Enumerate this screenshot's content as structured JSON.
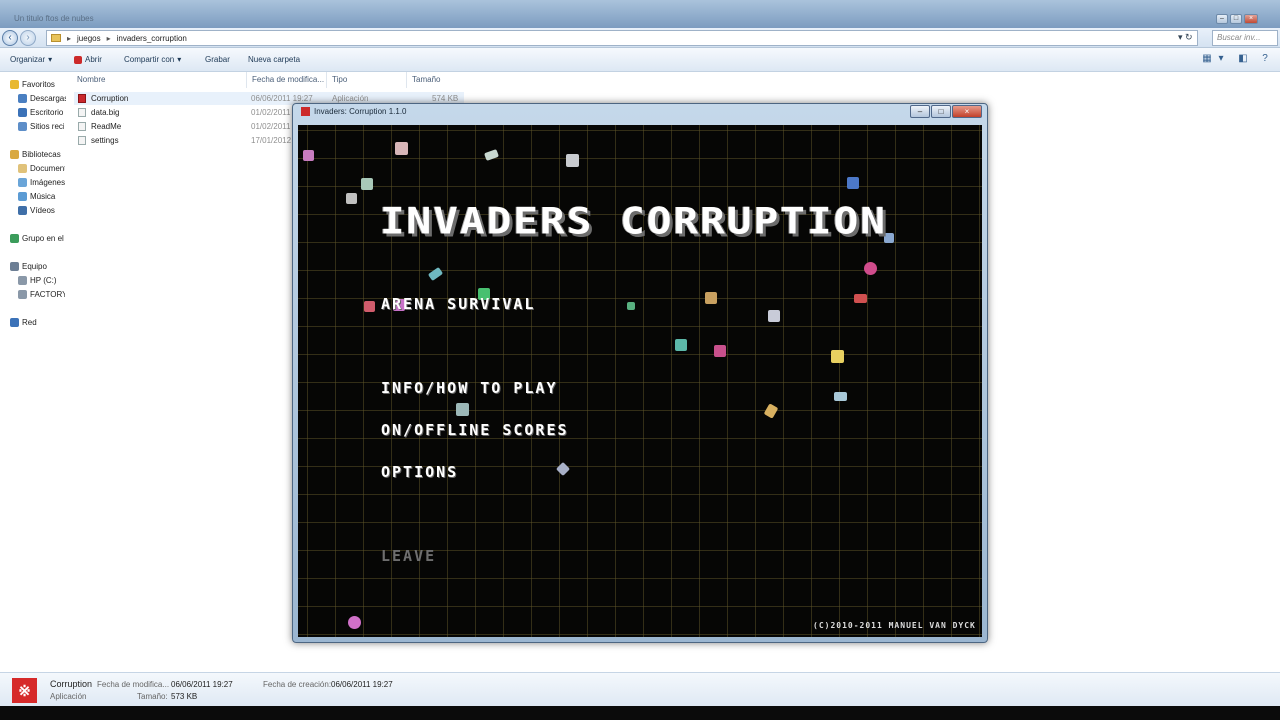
{
  "explorer": {
    "window_title": "Un titulo ftos de nubes",
    "breadcrumb": [
      "juegos",
      "invaders_corruption"
    ],
    "search_placeholder": "Buscar inv...",
    "toolbar": {
      "organizar": "Organizar",
      "abrir": "Abrir",
      "compartir": "Compartir con",
      "grabar": "Grabar",
      "nueva_carpeta": "Nueva carpeta"
    },
    "sidebar": {
      "favoritos": "Favoritos",
      "descargas": "Descargas",
      "escritorio": "Escritorio",
      "sitios": "Sitios recientes",
      "bibliotecas": "Bibliotecas",
      "documentos": "Documentos",
      "imagenes": "Imágenes",
      "musica": "Música",
      "videos": "Vídeos",
      "grupo": "Grupo en el hogar",
      "equipo": "Equipo",
      "hp": "HP (C:)",
      "factory": "FACTORY",
      "red": "Red"
    },
    "columns": {
      "nombre": "Nombre",
      "fecha": "Fecha de modifica...",
      "tipo": "Tipo",
      "tamano": "Tamaño"
    },
    "files": [
      {
        "name": "Corruption",
        "date": "06/06/2011 19:27",
        "type": "Aplicación",
        "size": "574 KB"
      },
      {
        "name": "data.big",
        "date": "01/02/2011"
      },
      {
        "name": "ReadMe",
        "date": "01/02/2011"
      },
      {
        "name": "settings",
        "date": "17/01/2012"
      }
    ],
    "details": {
      "name": "Corruption",
      "type": "Aplicación",
      "mod_label": "Fecha de modifica...",
      "mod_value": "06/06/2011 19:27",
      "size_label": "Tamaño:",
      "size_value": "573 KB",
      "created_label": "Fecha de creación:",
      "created_value": "06/06/2011 19:27"
    }
  },
  "game": {
    "window_title": "Invaders: Corruption 1.1.0",
    "title": "INVADERS CORRUPTION",
    "menu": {
      "arena": "ARENA SURVIVAL",
      "info": "INFO/HOW TO PLAY",
      "scores": "ON/OFFLINE SCORES",
      "options": "OPTIONS",
      "leave": "LEAVE"
    },
    "copyright": "(C)2010-2011 MANUEL VAN DYCK"
  },
  "colors": {
    "game_bg": "#060605",
    "grid": "#60562a",
    "accent_red": "#cc2a2a"
  }
}
